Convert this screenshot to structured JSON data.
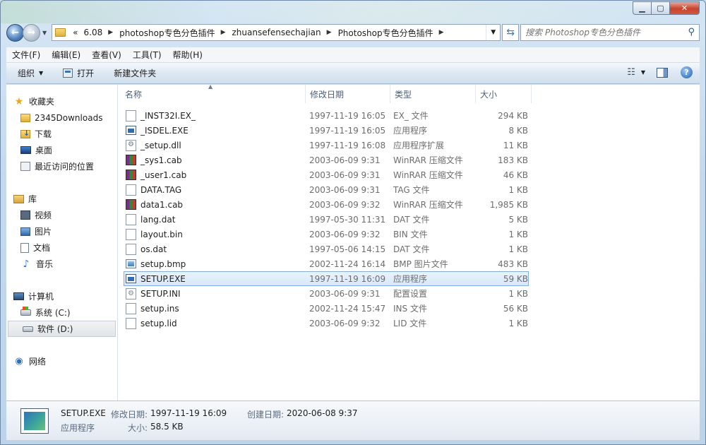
{
  "window": {
    "controls": {
      "minimize": "▁",
      "maximize": "▢",
      "close": "✕"
    }
  },
  "nav": {
    "back_icon": "back-arrow-icon",
    "forward_icon": "forward-arrow-icon",
    "back_glyph": "←",
    "forward_glyph": "→"
  },
  "address": {
    "overflow": "«",
    "crumbs": [
      "6.08",
      "photoshop专色分色插件",
      "zhuansefensechajian",
      "Photoshop专色分色插件"
    ]
  },
  "search": {
    "placeholder": "搜索 Photoshop专色分色插件"
  },
  "menu": [
    "文件(F)",
    "编辑(E)",
    "查看(V)",
    "工具(T)",
    "帮助(H)"
  ],
  "toolbar": {
    "organize": "组织",
    "open": "打开",
    "new_folder": "新建文件夹"
  },
  "sidebar": {
    "favorites": {
      "label": "收藏夹",
      "items": [
        "2345Downloads",
        "下载",
        "桌面",
        "最近访问的位置"
      ]
    },
    "libraries": {
      "label": "库",
      "items": [
        "视频",
        "图片",
        "文档",
        "音乐"
      ]
    },
    "computer": {
      "label": "计算机",
      "items": [
        "系统 (C:)",
        "软件 (D:)"
      ]
    },
    "network": {
      "label": "网络"
    }
  },
  "columns": {
    "name": "名称",
    "date": "修改日期",
    "type": "类型",
    "size": "大小"
  },
  "files": [
    {
      "name": "_INST32I.EX_",
      "date": "1997-11-19 16:05",
      "type": "EX_ 文件",
      "size": "294 KB",
      "icon": "blank"
    },
    {
      "name": "_ISDEL.EXE",
      "date": "1997-11-19 16:05",
      "type": "应用程序",
      "size": "8 KB",
      "icon": "exe"
    },
    {
      "name": "_setup.dll",
      "date": "1997-11-19 16:08",
      "type": "应用程序扩展",
      "size": "11 KB",
      "icon": "dll"
    },
    {
      "name": "_sys1.cab",
      "date": "2003-06-09 9:31",
      "type": "WinRAR 压缩文件",
      "size": "183 KB",
      "icon": "rar"
    },
    {
      "name": "_user1.cab",
      "date": "2003-06-09 9:31",
      "type": "WinRAR 压缩文件",
      "size": "46 KB",
      "icon": "rar"
    },
    {
      "name": "DATA.TAG",
      "date": "2003-06-09 9:31",
      "type": "TAG 文件",
      "size": "1 KB",
      "icon": "blank"
    },
    {
      "name": "data1.cab",
      "date": "2003-06-09 9:32",
      "type": "WinRAR 压缩文件",
      "size": "1,985 KB",
      "icon": "rar"
    },
    {
      "name": "lang.dat",
      "date": "1997-05-30 11:31",
      "type": "DAT 文件",
      "size": "5 KB",
      "icon": "blank"
    },
    {
      "name": "layout.bin",
      "date": "2003-06-09 9:32",
      "type": "BIN 文件",
      "size": "1 KB",
      "icon": "blank"
    },
    {
      "name": "os.dat",
      "date": "1997-05-06 14:15",
      "type": "DAT 文件",
      "size": "1 KB",
      "icon": "blank"
    },
    {
      "name": "setup.bmp",
      "date": "2002-11-24 16:14",
      "type": "BMP 图片文件",
      "size": "483 KB",
      "icon": "bmp"
    },
    {
      "name": "SETUP.EXE",
      "date": "1997-11-19 16:09",
      "type": "应用程序",
      "size": "59 KB",
      "icon": "exe",
      "selected": true
    },
    {
      "name": "SETUP.INI",
      "date": "2003-06-09 9:31",
      "type": "配置设置",
      "size": "1 KB",
      "icon": "ini"
    },
    {
      "name": "setup.ins",
      "date": "2002-11-24 15:47",
      "type": "INS 文件",
      "size": "56 KB",
      "icon": "blank"
    },
    {
      "name": "setup.lid",
      "date": "2003-06-09 9:32",
      "type": "LID 文件",
      "size": "1 KB",
      "icon": "blank"
    }
  ],
  "details": {
    "name": "SETUP.EXE",
    "modified_label": "修改日期:",
    "modified": "1997-11-19 16:09",
    "created_label": "创建日期:",
    "created": "2020-06-08 9:37",
    "type": "应用程序",
    "size_label": "大小:",
    "size": "58.5 KB"
  }
}
